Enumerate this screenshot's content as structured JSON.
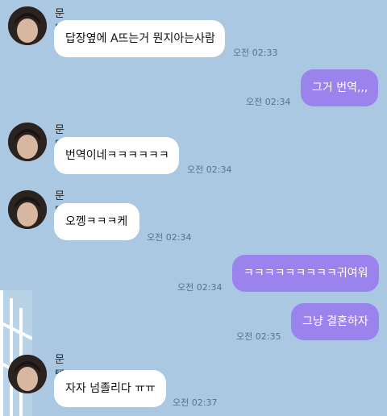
{
  "messages": [
    {
      "side": "in",
      "sender": "문텔",
      "text": "답장옆에 A뜨는거 뭔지아는사람",
      "time": "오전 02:33"
    },
    {
      "side": "out",
      "text": "그거 번역,,,",
      "time": "오전 02:34"
    },
    {
      "side": "in",
      "sender": "문텔",
      "text": "번역이네ㅋㅋㅋㅋㅋㅋ",
      "time": "오전 02:34"
    },
    {
      "side": "in",
      "sender": "문텔",
      "text": "오껭ㅋㅋㅋ케",
      "time": "오전 02:34"
    },
    {
      "side": "out",
      "text": "ㅋㅋㅋㅋㅋㅋㅋㅋㅋ귀여워",
      "time": "오전 02:34"
    },
    {
      "side": "out",
      "text": "그냥 결혼하자",
      "time": "오전 02:35"
    },
    {
      "side": "in",
      "sender": "문텔",
      "text": "자자 넘졸리다 ㅠㅠ",
      "time": "오전 02:37"
    }
  ]
}
